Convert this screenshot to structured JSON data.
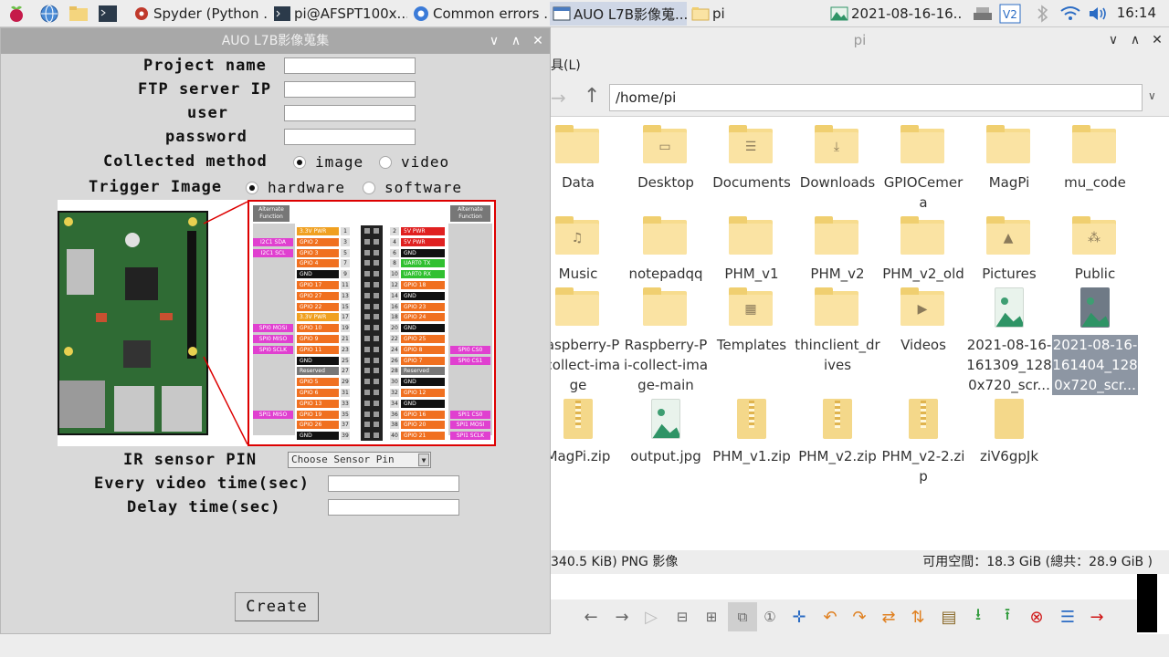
{
  "taskbar": {
    "tasks": [
      {
        "label": "Spyder (Python ..."
      },
      {
        "label": "pi@AFSPT100x..."
      },
      {
        "label": "Common errors ..."
      },
      {
        "label": "AUO L7B影像蒐..."
      },
      {
        "label": "pi"
      },
      {
        "label": "2021-08-16-16..."
      }
    ],
    "clock": "16:14"
  },
  "app": {
    "title": "AUO L7B影像蒐集",
    "fields": {
      "project_name": "Project name",
      "ftp_server_ip": "FTP server IP",
      "user": "user",
      "password": "password"
    },
    "collected_method": {
      "label": "Collected method",
      "options": [
        "image",
        "video"
      ],
      "selected": "image"
    },
    "trigger_image": {
      "label": "Trigger Image",
      "options": [
        "hardware",
        "software"
      ],
      "selected": "hardware"
    },
    "ir_sensor_label": "IR sensor PIN",
    "sensor_select_value": "Choose Sensor Pin",
    "every_video_time_label": "Every video time(sec)",
    "delay_time_label": "Delay time(sec)",
    "create_button": "Create",
    "pin_header_label": "Alternate Function",
    "left_pins": [
      {
        "n": "1",
        "t": "3.3V PWR",
        "c": "#f0a020",
        "f": ""
      },
      {
        "n": "3",
        "t": "GPIO 2",
        "c": "#f07020",
        "f": "I2C1 SDA"
      },
      {
        "n": "5",
        "t": "GPIO 3",
        "c": "#f07020",
        "f": "I2C1 SCL"
      },
      {
        "n": "7",
        "t": "GPIO 4",
        "c": "#f07020",
        "f": ""
      },
      {
        "n": "9",
        "t": "GND",
        "c": "#111111",
        "f": ""
      },
      {
        "n": "11",
        "t": "GPIO 17",
        "c": "#f07020",
        "f": ""
      },
      {
        "n": "13",
        "t": "GPIO 27",
        "c": "#f07020",
        "f": ""
      },
      {
        "n": "15",
        "t": "GPIO 22",
        "c": "#f07020",
        "f": ""
      },
      {
        "n": "17",
        "t": "3.3V PWR",
        "c": "#f0a020",
        "f": ""
      },
      {
        "n": "19",
        "t": "GPIO 10",
        "c": "#f07020",
        "f": "SPI0 MOSI"
      },
      {
        "n": "21",
        "t": "GPIO 9",
        "c": "#f07020",
        "f": "SPI0 MISO"
      },
      {
        "n": "23",
        "t": "GPIO 11",
        "c": "#f07020",
        "f": "SPI0 SCLK"
      },
      {
        "n": "25",
        "t": "GND",
        "c": "#111111",
        "f": ""
      },
      {
        "n": "27",
        "t": "Reserved",
        "c": "#777777",
        "f": ""
      },
      {
        "n": "29",
        "t": "GPIO 5",
        "c": "#f07020",
        "f": ""
      },
      {
        "n": "31",
        "t": "GPIO 6",
        "c": "#f07020",
        "f": ""
      },
      {
        "n": "33",
        "t": "GPIO 13",
        "c": "#f07020",
        "f": ""
      },
      {
        "n": "35",
        "t": "GPIO 19",
        "c": "#f07020",
        "f": "SPI1 MISO"
      },
      {
        "n": "37",
        "t": "GPIO 26",
        "c": "#f07020",
        "f": ""
      },
      {
        "n": "39",
        "t": "GND",
        "c": "#111111",
        "f": ""
      }
    ],
    "right_pins": [
      {
        "n": "2",
        "t": "5V PWR",
        "c": "#e02020",
        "f": ""
      },
      {
        "n": "4",
        "t": "5V PWR",
        "c": "#e02020",
        "f": ""
      },
      {
        "n": "6",
        "t": "GND",
        "c": "#111111",
        "f": ""
      },
      {
        "n": "8",
        "t": "UART0 TX",
        "c": "#30c030",
        "f": ""
      },
      {
        "n": "10",
        "t": "UART0 RX",
        "c": "#30c030",
        "f": ""
      },
      {
        "n": "12",
        "t": "GPIO 18",
        "c": "#f07020",
        "f": ""
      },
      {
        "n": "14",
        "t": "GND",
        "c": "#111111",
        "f": ""
      },
      {
        "n": "16",
        "t": "GPIO 23",
        "c": "#f07020",
        "f": ""
      },
      {
        "n": "18",
        "t": "GPIO 24",
        "c": "#f07020",
        "f": ""
      },
      {
        "n": "20",
        "t": "GND",
        "c": "#111111",
        "f": ""
      },
      {
        "n": "22",
        "t": "GPIO 25",
        "c": "#f07020",
        "f": ""
      },
      {
        "n": "24",
        "t": "GPIO 8",
        "c": "#f07020",
        "f": "SPI0 CS0"
      },
      {
        "n": "26",
        "t": "GPIO 7",
        "c": "#f07020",
        "f": "SPI0 CS1"
      },
      {
        "n": "28",
        "t": "Reserved",
        "c": "#777777",
        "f": ""
      },
      {
        "n": "30",
        "t": "GND",
        "c": "#111111",
        "f": ""
      },
      {
        "n": "32",
        "t": "GPIO 12",
        "c": "#f07020",
        "f": ""
      },
      {
        "n": "34",
        "t": "GND",
        "c": "#111111",
        "f": ""
      },
      {
        "n": "36",
        "t": "GPIO 16",
        "c": "#f07020",
        "f": "SPI1 CS0"
      },
      {
        "n": "38",
        "t": "GPIO 20",
        "c": "#f07020",
        "f": "SPI1 MOSI"
      },
      {
        "n": "40",
        "t": "GPIO 21",
        "c": "#f07020",
        "f": "SPI1 SCLK"
      }
    ]
  },
  "filemanager": {
    "title": "pi",
    "menu_fragment": "具(L)",
    "path": "/home/pi",
    "files": [
      {
        "name": "Data",
        "kind": "folder",
        "badge": ""
      },
      {
        "name": "Desktop",
        "kind": "folder",
        "badge": "desktop"
      },
      {
        "name": "Documents",
        "kind": "folder",
        "badge": "documents"
      },
      {
        "name": "Downloads",
        "kind": "folder",
        "badge": "downloads"
      },
      {
        "name": "GPIOCemera",
        "kind": "folder",
        "badge": ""
      },
      {
        "name": "MagPi",
        "kind": "folder",
        "badge": ""
      },
      {
        "name": "mu_code",
        "kind": "folder",
        "badge": ""
      },
      {
        "name": "Music",
        "kind": "folder",
        "badge": "music"
      },
      {
        "name": "notepadqq",
        "kind": "folder",
        "badge": ""
      },
      {
        "name": "PHM_v1",
        "kind": "folder",
        "badge": ""
      },
      {
        "name": "PHM_v2",
        "kind": "folder",
        "badge": ""
      },
      {
        "name": "PHM_v2_old",
        "kind": "folder",
        "badge": ""
      },
      {
        "name": "Pictures",
        "kind": "folder",
        "badge": "pictures"
      },
      {
        "name": "Public",
        "kind": "folder",
        "badge": "public"
      },
      {
        "name": "Raspberry-Pi-collect-image",
        "kind": "folder",
        "badge": ""
      },
      {
        "name": "Raspberry-Pi-collect-image-main",
        "kind": "folder",
        "badge": ""
      },
      {
        "name": "Templates",
        "kind": "folder",
        "badge": "templates"
      },
      {
        "name": "thinclient_drives",
        "kind": "folder",
        "badge": ""
      },
      {
        "name": "Videos",
        "kind": "folder",
        "badge": "videos"
      },
      {
        "name": "2021-08-16-161309_1280x720_scr...",
        "kind": "image",
        "badge": ""
      },
      {
        "name": "2021-08-16-161404_1280x720_scr...",
        "kind": "image",
        "badge": "",
        "selected": true
      },
      {
        "name": "MagPi.zip",
        "kind": "zip",
        "badge": ""
      },
      {
        "name": "output.jpg",
        "kind": "image",
        "badge": ""
      },
      {
        "name": "PHM_v1.zip",
        "kind": "zip",
        "badge": ""
      },
      {
        "name": "PHM_v2.zip",
        "kind": "zip",
        "badge": ""
      },
      {
        "name": "PHM_v2-2.zip",
        "kind": "zip",
        "badge": ""
      },
      {
        "name": "ziV6gpJk",
        "kind": "file",
        "badge": ""
      }
    ],
    "status_left": "340.5 KiB) PNG 影像",
    "status_right": "可用空間：18.3 GiB (總共：28.9 GiB )"
  }
}
